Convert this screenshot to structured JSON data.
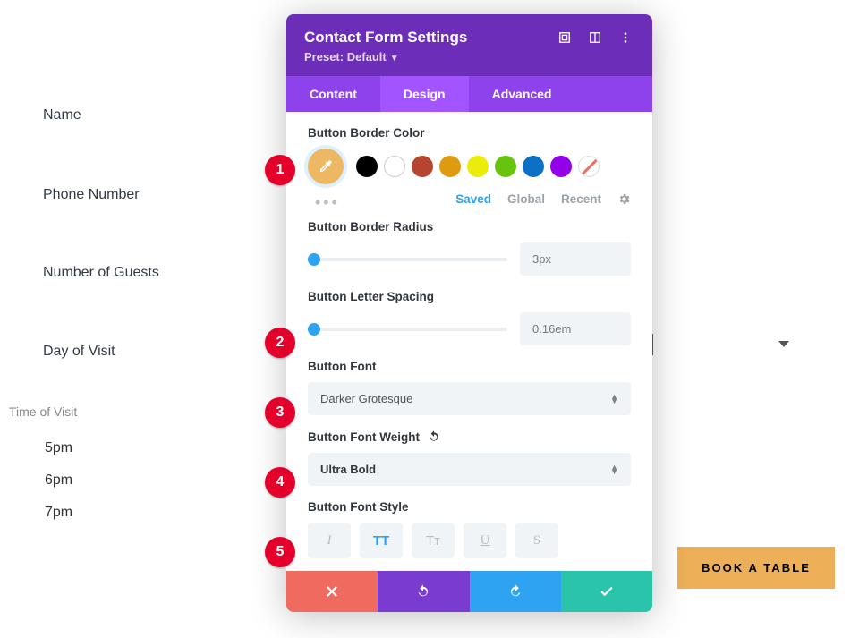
{
  "form": {
    "name": "Name",
    "phone": "Phone Number",
    "guests": "Number of Guests",
    "day": "Day of Visit",
    "tov_label": "Time of Visit",
    "times": [
      "5pm",
      "6pm",
      "7pm"
    ]
  },
  "cta": {
    "label": "BOOK A TABLE"
  },
  "panel": {
    "title": "Contact Form Settings",
    "preset": "Preset: Default",
    "tabs": {
      "content": "Content",
      "design": "Design",
      "advanced": "Advanced"
    },
    "border_color_label": "Button Border Color",
    "meta": {
      "saved": "Saved",
      "global": "Global",
      "recent": "Recent"
    },
    "border_radius_label": "Button Border Radius",
    "border_radius_value": "3px",
    "letter_spacing_label": "Button Letter Spacing",
    "letter_spacing_value": "0.16em",
    "font_label": "Button Font",
    "font_value": "Darker Grotesque",
    "font_weight_label": "Button Font Weight",
    "font_weight_value": "Ultra Bold",
    "font_style_label": "Button Font Style",
    "style_buttons": {
      "italic": "I",
      "uppercase": "TT",
      "smallcaps": "Tᴛ",
      "underline": "U",
      "strike": "S"
    }
  },
  "badges": [
    "1",
    "2",
    "3",
    "4",
    "5"
  ],
  "colors": {
    "eyedropper": "#ecb863",
    "swatches": [
      "#000000",
      "#ffffff",
      "#b5452f",
      "#e09a0f",
      "#ecec0a",
      "#67c40d",
      "#0c70c4",
      "#9400ea",
      "none"
    ]
  }
}
